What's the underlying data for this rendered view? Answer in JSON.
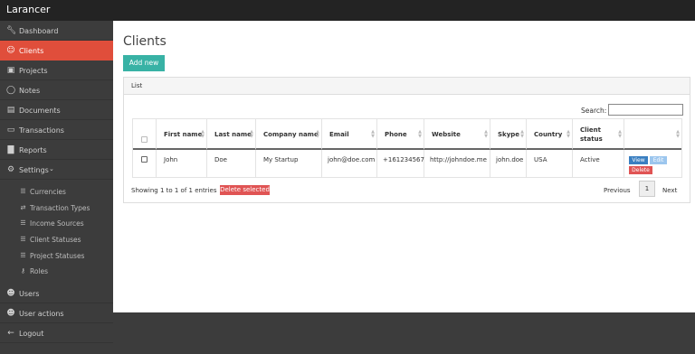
{
  "app": {
    "title": "Larancer"
  },
  "sidebar": {
    "items": [
      {
        "label": "Dashboard",
        "icon": "wrench-icon"
      },
      {
        "label": "Clients",
        "icon": "users-plus-icon",
        "active": true
      },
      {
        "label": "Projects",
        "icon": "briefcase-icon"
      },
      {
        "label": "Notes",
        "icon": "comment-icon"
      },
      {
        "label": "Documents",
        "icon": "file-icon"
      },
      {
        "label": "Transactions",
        "icon": "credit-card-icon"
      },
      {
        "label": "Reports",
        "icon": "bar-chart-icon"
      },
      {
        "label": "Settings",
        "icon": "gears-icon",
        "expanded": true
      }
    ],
    "settings_sub": [
      {
        "label": "Currencies",
        "icon": "list-icon"
      },
      {
        "label": "Transaction Types",
        "icon": "exchange-icon"
      },
      {
        "label": "Income Sources",
        "icon": "database-icon"
      },
      {
        "label": "Client Statuses",
        "icon": "list-icon"
      },
      {
        "label": "Project Statuses",
        "icon": "list-icon"
      },
      {
        "label": "Roles",
        "icon": "key-icon"
      }
    ],
    "bottom_items": [
      {
        "label": "Users",
        "icon": "users-icon"
      },
      {
        "label": "User actions",
        "icon": "users-icon"
      },
      {
        "label": "Logout",
        "icon": "arrow-left-icon"
      }
    ]
  },
  "main": {
    "title": "Clients",
    "add_button": "Add new",
    "panel_title": "List",
    "search_label": "Search:",
    "columns": [
      "First name",
      "Last name",
      "Company name",
      "Email",
      "Phone",
      "Website",
      "Skype",
      "Country",
      "Client status"
    ],
    "rows": [
      {
        "first": "John",
        "last": "Doe",
        "company": "My Startup",
        "email": "john@doe.com",
        "phone": "+161234567",
        "website": "http://johndoe.me",
        "skype": "john.doe",
        "country": "USA",
        "status": "Active"
      }
    ],
    "row_actions": {
      "view": "View",
      "edit": "Edit",
      "delete": "Delete"
    },
    "info": "Showing 1 to 1 of 1 entries",
    "delete_selected": "Delete selected",
    "pagination": {
      "prev": "Previous",
      "page": "1",
      "next": "Next"
    }
  },
  "colors": {
    "accent": "#e04e3b",
    "primary": "#38b2a5",
    "danger": "#e05454",
    "view": "#3a7fc1",
    "edit": "#9cc6ee"
  }
}
